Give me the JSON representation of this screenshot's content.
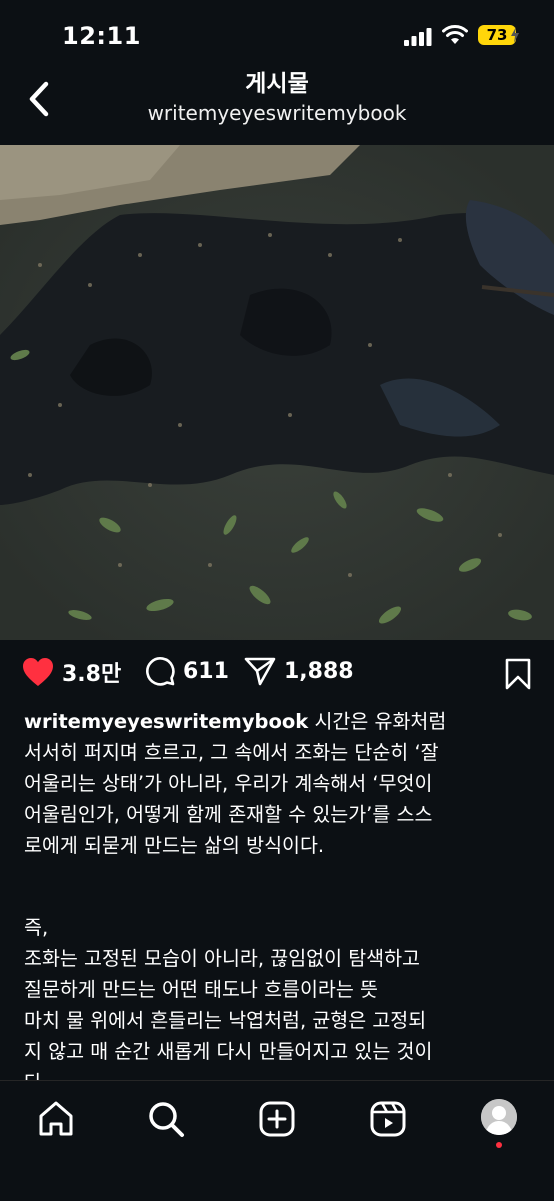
{
  "status_bar": {
    "time": "12:11",
    "battery": "73"
  },
  "header": {
    "title": "게시물",
    "username": "writemyeyeswritemybook"
  },
  "post": {
    "likes": "3.8만",
    "comments": "611",
    "shares": "1,888",
    "caption_user": "writemyeyeswritemybook",
    "caption_lines": [
      " 시간은 유화처럼",
      "서서히 퍼지며 흐르고, 그 속에서 조화는 단순히 ‘잘",
      "어울리는 상태’가 아니라, 우리가 계속해서 ‘무엇이",
      "어울림인가, 어떻게 함께 존재할 수 있는가’를 스스",
      "로에게 되묻게 만드는 삶의 방식이다.",
      "즉,",
      "조화는 고정된 모습이 아니라, 끊임없이 탐색하고",
      "질문하게 만드는 어떤 태도나 흐름이라는 뜻",
      "마치 물 위에서 흔들리는 낙엽처럼, 균형은 고정되",
      "지 않고 매 순간 새롭게 다시 만들어지고 있는 것이",
      "다."
    ]
  },
  "icons": {
    "back": "chevron-left-icon",
    "like": "heart-icon",
    "comment": "comment-icon",
    "share": "paper-plane-icon",
    "save": "bookmark-icon",
    "sound": "speaker-icon",
    "nav": [
      "home-icon",
      "search-icon",
      "create-icon",
      "reels-icon",
      "profile-avatar"
    ]
  },
  "colors": {
    "background": "#0c1014",
    "like": "#ff3040",
    "battery": "#ffd60a"
  }
}
